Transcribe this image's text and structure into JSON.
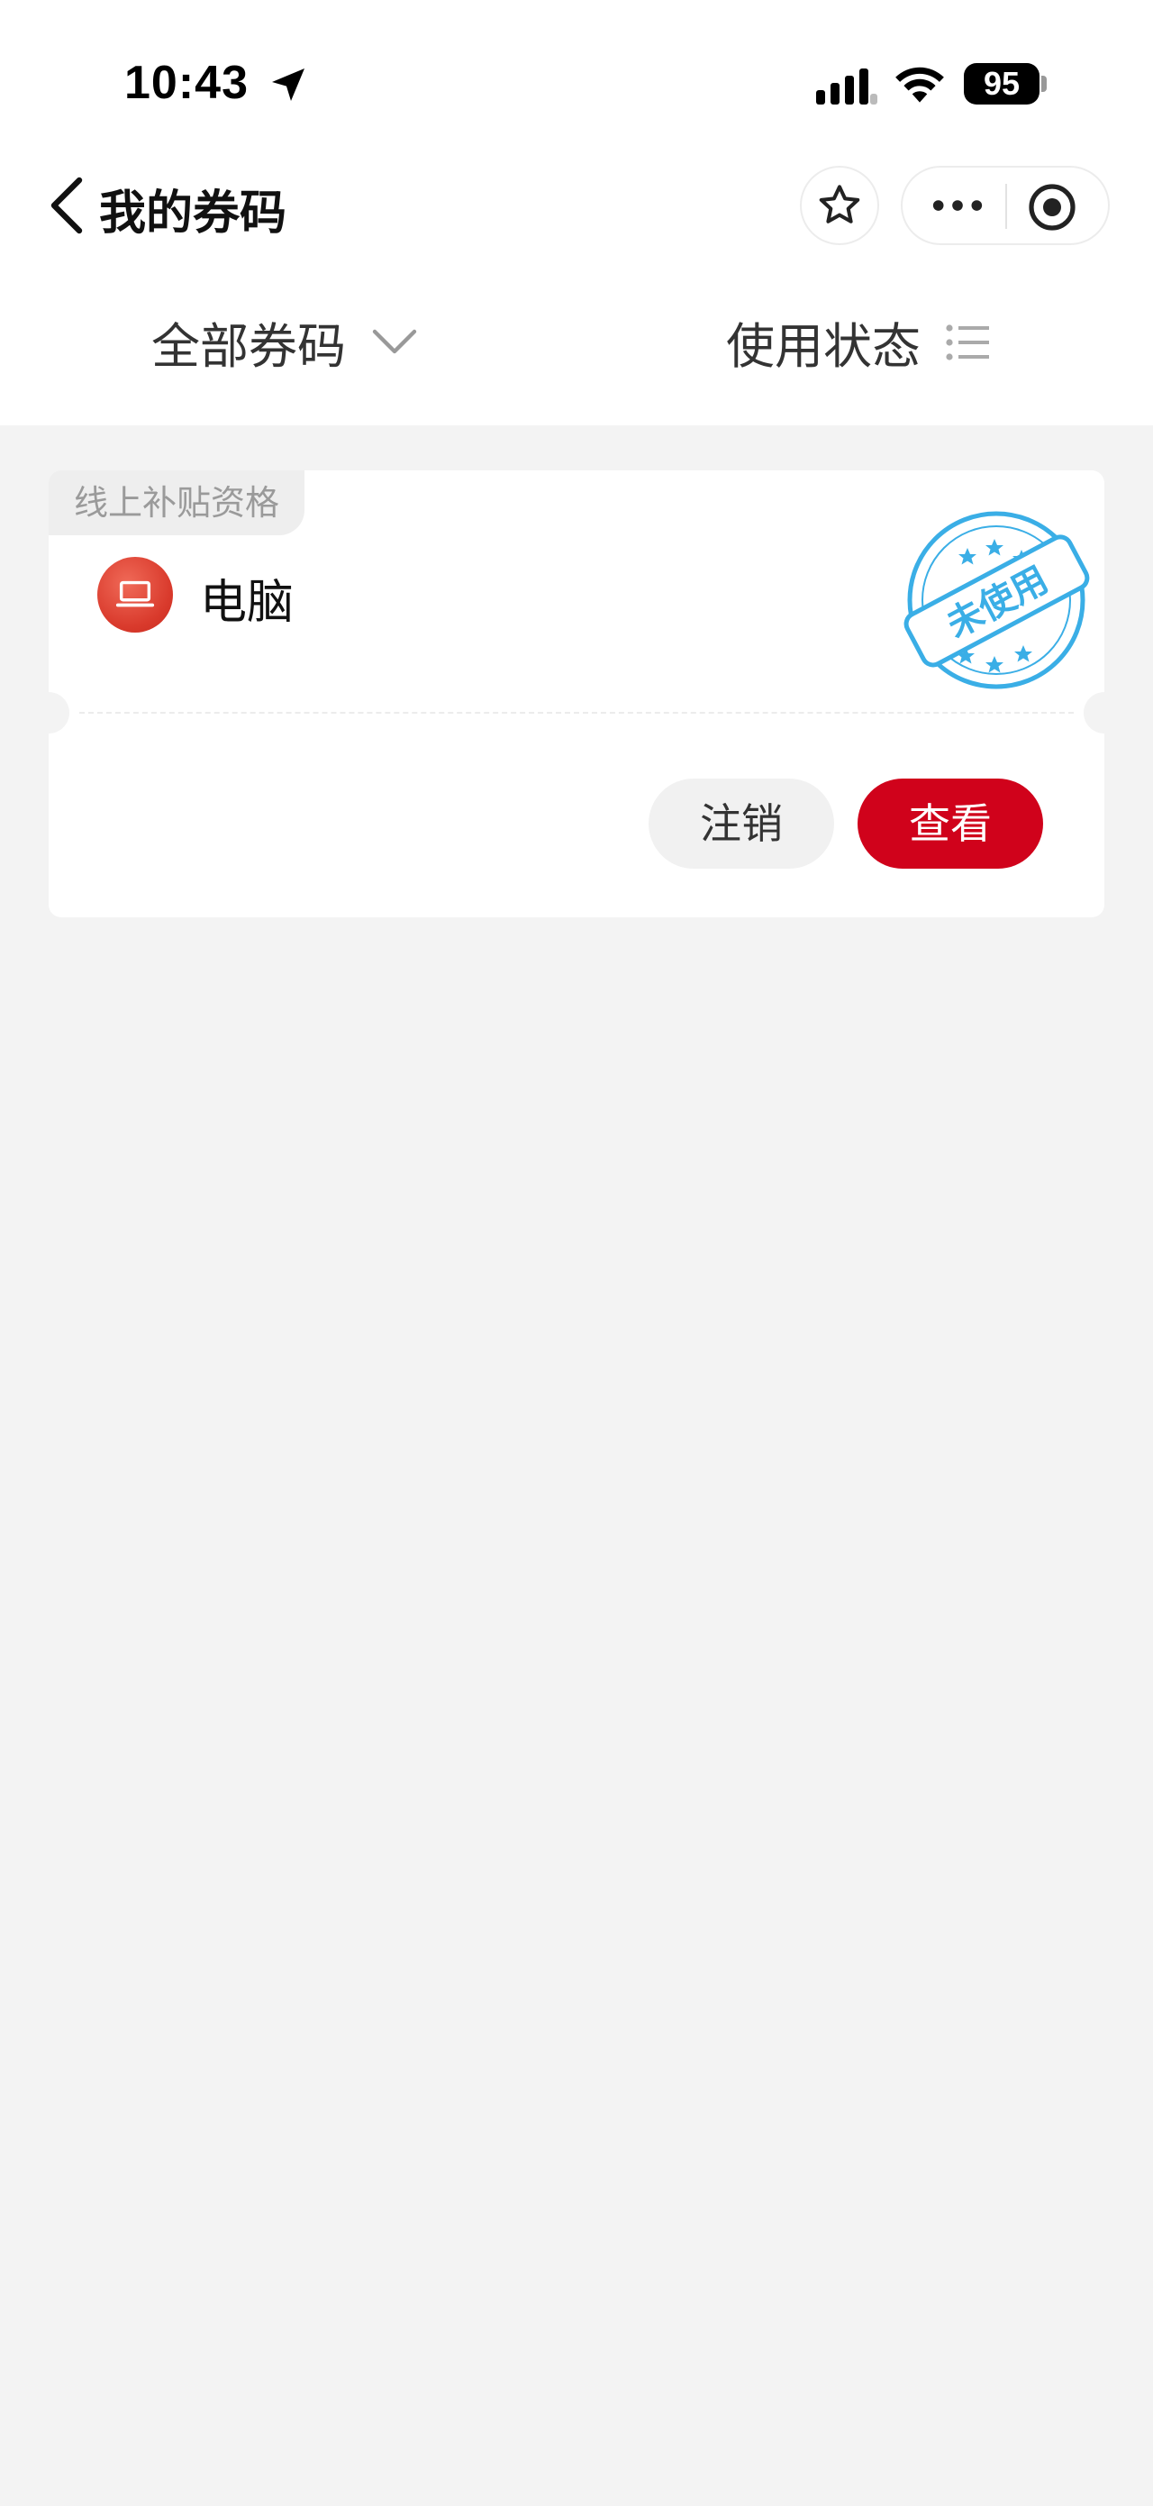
{
  "status_bar": {
    "time": "10:43",
    "battery": "95"
  },
  "nav": {
    "title": "我的券码",
    "icons": [
      "back-icon",
      "star-icon",
      "more-icon",
      "target-icon"
    ]
  },
  "filters": {
    "all_label": "全部券码",
    "status_label": "使用状态"
  },
  "coupons": [
    {
      "tag": "线上补贴资格",
      "name": "电脑",
      "icon": "laptop-icon",
      "stamp": "未使用",
      "cancel_label": "注销",
      "view_label": "查看"
    }
  ],
  "colors": {
    "accent": "#d0021b",
    "stamp": "#3aaee6",
    "background": "#f3f3f3"
  }
}
